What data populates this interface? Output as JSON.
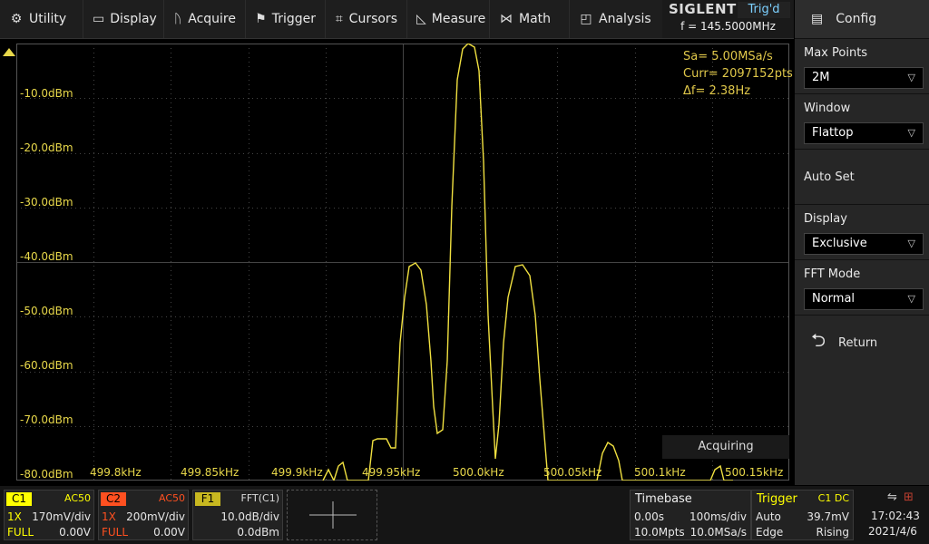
{
  "menu": [
    {
      "label": "Utility",
      "icon": "⚙"
    },
    {
      "label": "Display",
      "icon": "▭"
    },
    {
      "label": "Acquire",
      "icon": "ᚢ"
    },
    {
      "label": "Trigger",
      "icon": "⚑"
    },
    {
      "label": "Cursors",
      "icon": "⌗"
    },
    {
      "label": "Measure",
      "icon": "◺"
    },
    {
      "label": "Math",
      "icon": "⋈"
    },
    {
      "label": "Analysis",
      "icon": "◰"
    }
  ],
  "brand": {
    "logo": "SIGLENT",
    "trig_status": "Trig'd",
    "freq": "f = 145.5000MHz"
  },
  "panel": {
    "title": "Config",
    "max_points_label": "Max Points",
    "max_points_value": "2M",
    "window_label": "Window",
    "window_value": "Flattop",
    "autoset_label": "Auto Set",
    "display_label": "Display",
    "display_value": "Exclusive",
    "fftmode_label": "FFT Mode",
    "fftmode_value": "Normal",
    "return_label": "Return"
  },
  "yaxis": [
    "-10.0dBm",
    "-20.0dBm",
    "-30.0dBm",
    "-40.0dBm",
    "-50.0dBm",
    "-60.0dBm",
    "-70.0dBm",
    "-80.0dBm"
  ],
  "xaxis": [
    "499.8kHz",
    "499.85kHz",
    "499.9kHz",
    "499.95kHz",
    "500.0kHz",
    "500.05kHz",
    "500.1kHz",
    "500.15kHz"
  ],
  "info": {
    "sa": "Sa=  5.00MSa/s",
    "curr": "Curr= 2097152pts",
    "df": "Δf=  2.38Hz"
  },
  "acquiring": "Acquiring",
  "channels": [
    {
      "tag": "C1",
      "tag_color": "#ffff00",
      "coupling": "AC50",
      "coupling_color": "#ffff00",
      "probe": "1X",
      "scale": "170mV/div",
      "bw": "FULL",
      "offset": "0.00V",
      "color": "#ffff00"
    },
    {
      "tag": "C2",
      "tag_color": "#ff5020",
      "coupling": "AC50",
      "coupling_color": "#ff5020",
      "probe": "1X",
      "scale": "200mV/div",
      "bw": "FULL",
      "offset": "0.00V",
      "color": "#ff5020"
    },
    {
      "tag": "F1",
      "tag_color": "#c8b820",
      "coupling": "FFT(C1)",
      "coupling_color": "#dddddd",
      "probe": "",
      "scale": "10.0dB/div",
      "bw": "",
      "offset": "0.0dBm",
      "color": "#ffffff"
    }
  ],
  "timebase": {
    "label": "Timebase",
    "delay": "0.00s",
    "scale": "100ms/div",
    "points": "10.0Mpts",
    "rate": "10.0MSa/s"
  },
  "trigger": {
    "label": "Trigger",
    "source": "C1 DC",
    "mode": "Auto",
    "level": "39.7mV",
    "type": "Edge",
    "slope": "Rising"
  },
  "clock": {
    "time": "17:02:43",
    "date": "2021/4/6"
  },
  "colors": {
    "trace": "#f0e040",
    "grid": "#444444",
    "accent": "#e8d84a"
  }
}
